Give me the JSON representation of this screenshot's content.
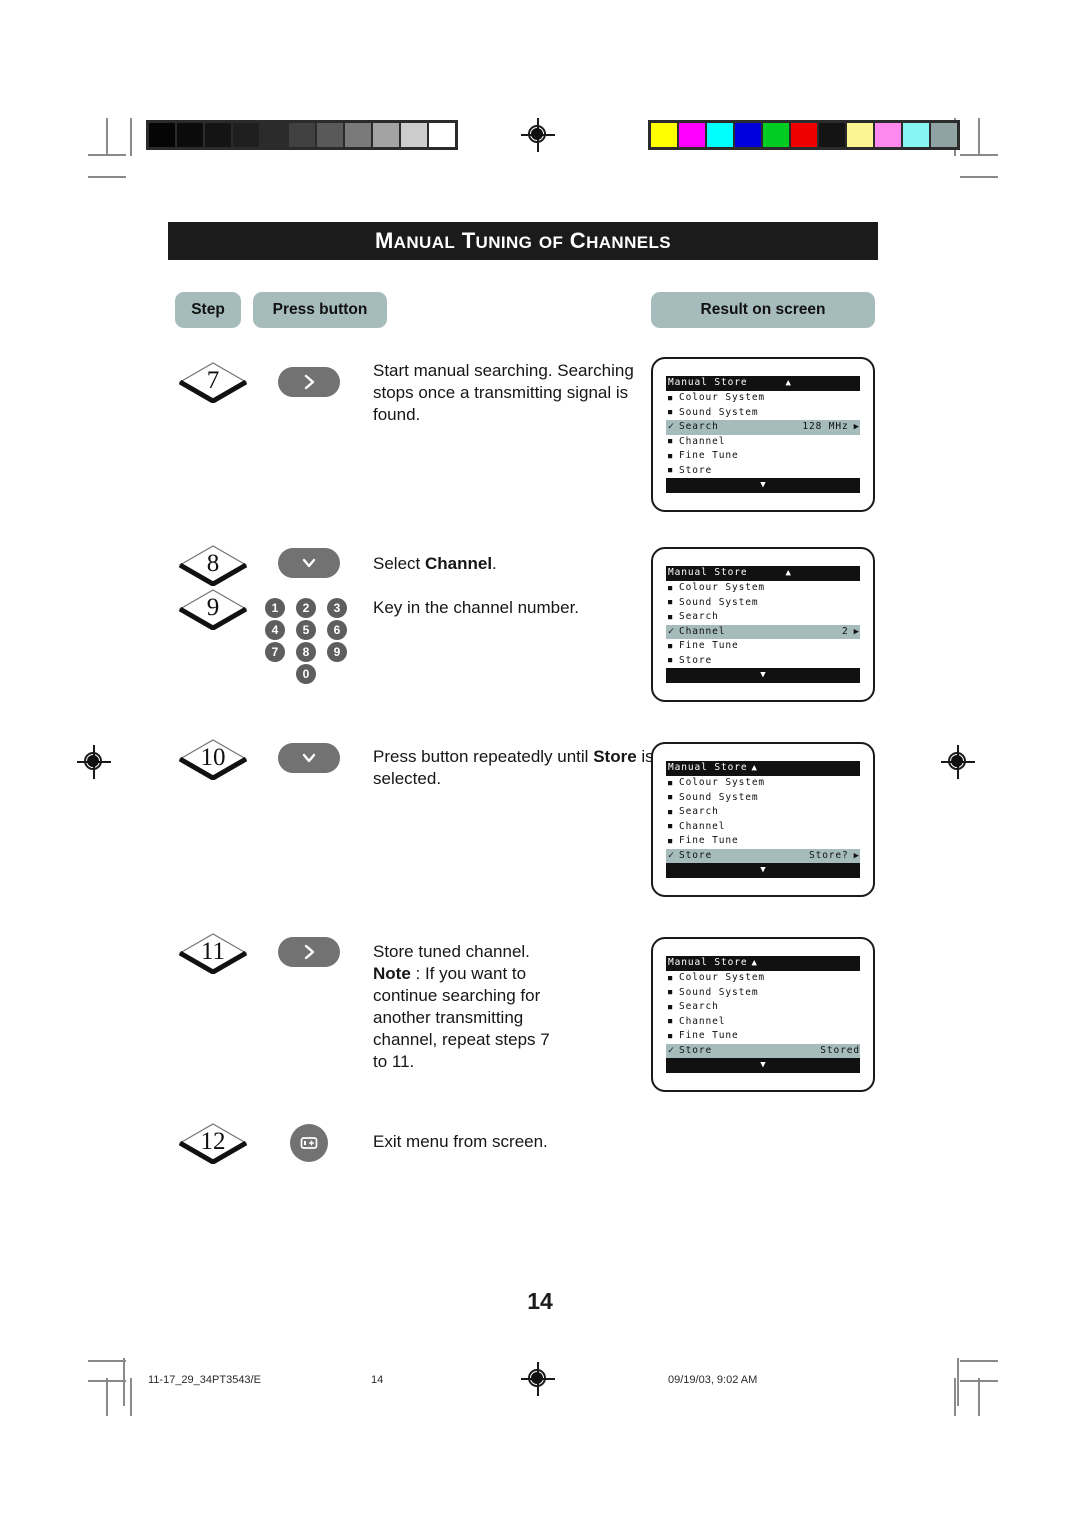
{
  "document": {
    "title": "Manual Tuning of Channels",
    "page_number": "14"
  },
  "headers": {
    "step": "Step",
    "press_button": "Press button",
    "result_on_screen": "Result on screen"
  },
  "colors": {
    "accent": "#a6bcbc",
    "title_bg": "#1b1b1b",
    "button_grey": "#727272",
    "key_grey": "#5e5e5e"
  },
  "steps": [
    {
      "number": "7",
      "button": "chevron-right",
      "text_html": "Start manual searching. Searching stops once a transmitting signal is found."
    },
    {
      "number": "8",
      "button": "chevron-down",
      "text_html": "Select <b>Channel</b>."
    },
    {
      "number": "9",
      "button": "keypad",
      "text_html": "Key in the channel number."
    },
    {
      "number": "10",
      "button": "chevron-down",
      "text_html": "Press button repeatedly until <b>Store</b> is selected."
    },
    {
      "number": "11",
      "button": "chevron-right",
      "text_html": "Store tuned  channel.<br><b>Note</b> : If you want to continue searching for another transmitting channel, repeat steps 7 to 11."
    },
    {
      "number": "12",
      "button": "menu-screen",
      "text_html": "Exit menu from screen."
    }
  ],
  "keypad": {
    "keys": [
      "1",
      "2",
      "3",
      "4",
      "5",
      "6",
      "7",
      "8",
      "9",
      "0"
    ]
  },
  "screens": [
    {
      "title": "Manual Store",
      "title_arrow": "▲",
      "title_spaced": true,
      "items": [
        {
          "label": "Colour System",
          "value": "",
          "arrow": "",
          "selected": false,
          "marker": "square"
        },
        {
          "label": "Sound System",
          "value": "",
          "arrow": "",
          "selected": false,
          "marker": "square"
        },
        {
          "label": "Search",
          "value": "128 MHz",
          "arrow": "▶",
          "selected": true,
          "marker": "check"
        },
        {
          "label": "Channel",
          "value": "",
          "arrow": "",
          "selected": false,
          "marker": "square"
        },
        {
          "label": "Fine Tune",
          "value": "",
          "arrow": "",
          "selected": false,
          "marker": "square"
        },
        {
          "label": "Store",
          "value": "",
          "arrow": "",
          "selected": false,
          "marker": "square"
        }
      ],
      "foot_arrow": "▼"
    },
    {
      "title": "Manual Store",
      "title_arrow": "▲",
      "title_spaced": true,
      "items": [
        {
          "label": "Colour System",
          "value": "",
          "arrow": "",
          "selected": false,
          "marker": "square"
        },
        {
          "label": "Sound System",
          "value": "",
          "arrow": "",
          "selected": false,
          "marker": "square"
        },
        {
          "label": "Search",
          "value": "",
          "arrow": "",
          "selected": false,
          "marker": "square"
        },
        {
          "label": "Channel",
          "value": "2",
          "arrow": "▶",
          "selected": true,
          "marker": "check"
        },
        {
          "label": "Fine Tune",
          "value": "",
          "arrow": "",
          "selected": false,
          "marker": "square"
        },
        {
          "label": "Store",
          "value": "",
          "arrow": "",
          "selected": false,
          "marker": "square"
        }
      ],
      "foot_arrow": "▼"
    },
    {
      "title": "Manual Store",
      "title_arrow": "▲",
      "title_spaced": false,
      "items": [
        {
          "label": "Colour System",
          "value": "",
          "arrow": "",
          "selected": false,
          "marker": "square"
        },
        {
          "label": "Sound System",
          "value": "",
          "arrow": "",
          "selected": false,
          "marker": "square"
        },
        {
          "label": "Search",
          "value": "",
          "arrow": "",
          "selected": false,
          "marker": "square"
        },
        {
          "label": "Channel",
          "value": "",
          "arrow": "",
          "selected": false,
          "marker": "square"
        },
        {
          "label": "Fine Tune",
          "value": "",
          "arrow": "",
          "selected": false,
          "marker": "square"
        },
        {
          "label": "Store",
          "value": "Store?",
          "arrow": "▶",
          "selected": true,
          "marker": "check"
        }
      ],
      "foot_arrow": "▼"
    },
    {
      "title": "Manual Store",
      "title_arrow": "▲",
      "title_spaced": false,
      "items": [
        {
          "label": "Colour System",
          "value": "",
          "arrow": "",
          "selected": false,
          "marker": "square"
        },
        {
          "label": "Sound System",
          "value": "",
          "arrow": "",
          "selected": false,
          "marker": "square"
        },
        {
          "label": "Search",
          "value": "",
          "arrow": "",
          "selected": false,
          "marker": "square"
        },
        {
          "label": "Channel",
          "value": "",
          "arrow": "",
          "selected": false,
          "marker": "square"
        },
        {
          "label": "Fine Tune",
          "value": "",
          "arrow": "",
          "selected": false,
          "marker": "square"
        },
        {
          "label": "Store",
          "value": "Stored",
          "arrow": "",
          "selected": true,
          "marker": "check"
        }
      ],
      "foot_arrow": "▼"
    }
  ],
  "calibration": {
    "grayscale": [
      "#050505",
      "#0b0b0b",
      "#141414",
      "#1f1f1f",
      "#2b2b2b",
      "#414141",
      "#595959",
      "#7a7a7a",
      "#a3a3a3",
      "#cccccc",
      "#ffffff"
    ],
    "colorbars": [
      "#ffff00",
      "#ff00ff",
      "#00ffff",
      "#0000dd",
      "#00cc22",
      "#ee0000",
      "#141414",
      "#fcf692",
      "#ff88ee",
      "#88f5f5",
      "#8fa3a3"
    ]
  },
  "footer": {
    "filename": "11-17_29_34PT3543/E",
    "page": "14",
    "timestamp": "09/19/03, 9:02 AM"
  }
}
